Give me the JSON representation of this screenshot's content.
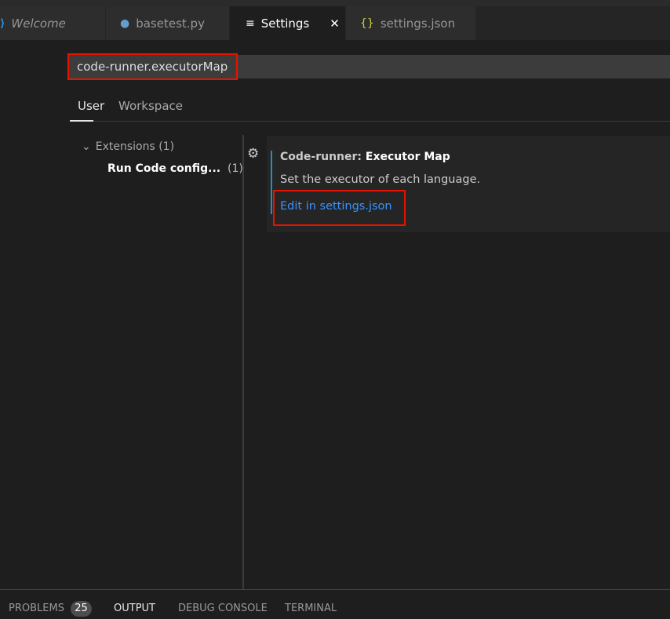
{
  "tabs": [
    {
      "label": "Welcome",
      "icon": "vscode-logo-icon"
    },
    {
      "label": "basetest.py",
      "icon": "python-icon"
    },
    {
      "label": "Settings",
      "icon": "settings-lines-icon",
      "active": true,
      "close": "✕"
    },
    {
      "label": "settings.json",
      "icon": "json-braces-icon",
      "icon_glyph": "{}"
    }
  ],
  "search": {
    "value": "code-runner.executorMap"
  },
  "scopes": {
    "user": "User",
    "workspace": "Workspace"
  },
  "tree": {
    "group": "Extensions (1)",
    "item": "Run Code config...",
    "item_count": "(1)"
  },
  "setting": {
    "category": "Code-runner: ",
    "name": "Executor Map",
    "description": "Set the executor of each language.",
    "link": "Edit in settings.json"
  },
  "panel": {
    "problems": "PROBLEMS",
    "problems_count": "25",
    "output": "OUTPUT",
    "debug": "DEBUG CONSOLE",
    "terminal": "TERMINAL"
  },
  "colors": {
    "link": "#3794ff",
    "highlight_box": "#e51400",
    "accent_bar": "#2e8cb8"
  }
}
